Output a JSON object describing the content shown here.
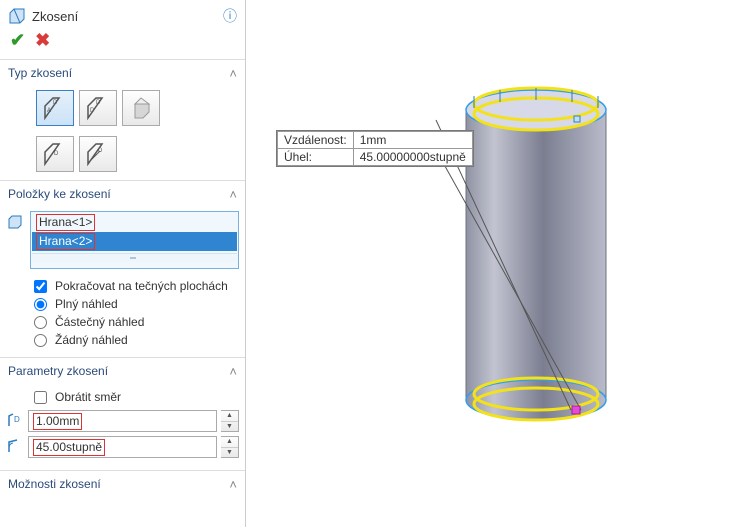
{
  "title": "Zkosení",
  "sections": {
    "chamfer_type": {
      "header": "Typ zkosení"
    },
    "items": {
      "header": "Položky ke zkosení",
      "entries": [
        "Hrana<1>",
        "Hrana<2>"
      ],
      "tangent_propagation": "Pokračovat na tečných plochách",
      "preview_full": "Plný náhled",
      "preview_partial": "Částečný náhled",
      "preview_none": "Žádný náhled"
    },
    "params": {
      "header": "Parametry zkosení",
      "reverse": "Obrátit směr",
      "distance": "1.00mm",
      "angle": "45.00stupně"
    },
    "options": {
      "header": "Možnosti zkosení"
    }
  },
  "callout": {
    "dist_label": "Vzdálenost:",
    "dist_value": "1mm",
    "angle_label": "Úhel:",
    "angle_value": "45.00000000stupně"
  }
}
